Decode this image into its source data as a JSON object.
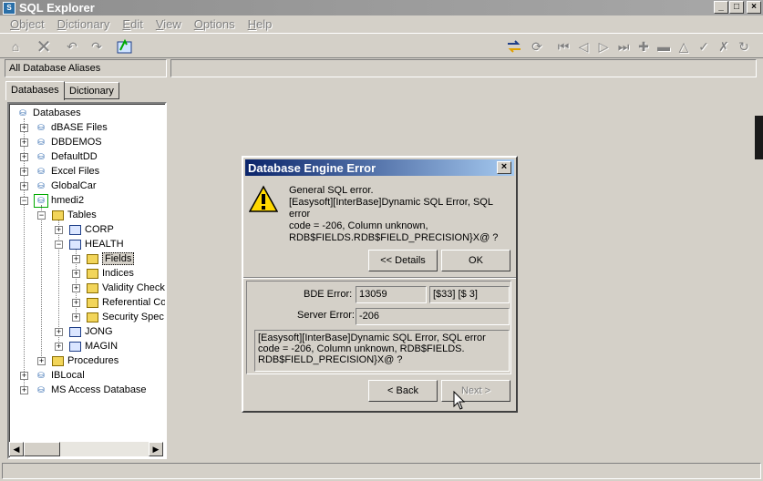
{
  "window": {
    "title": "SQL Explorer"
  },
  "menu": [
    {
      "label": "Object",
      "u": "O",
      "rest": "bject"
    },
    {
      "label": "Dictionary",
      "u": "D",
      "rest": "ictionary"
    },
    {
      "label": "Edit",
      "u": "E",
      "rest": "dit"
    },
    {
      "label": "View",
      "u": "V",
      "rest": "iew"
    },
    {
      "label": "Options",
      "u": "O",
      "rest": "ptions"
    },
    {
      "label": "Help",
      "u": "H",
      "rest": "elp"
    }
  ],
  "toolbar": {
    "left_icons": [
      "open-icon",
      "delete-icon",
      "undo-icon",
      "redo-icon",
      "query-icon"
    ],
    "right_icons": [
      "refresh-icon",
      "sync-icon",
      "first-icon",
      "prior-icon",
      "next-icon",
      "last-icon",
      "insert-icon",
      "delete-record-icon",
      "edit-icon",
      "post-icon",
      "cancel-icon",
      "refresh-data-icon"
    ]
  },
  "alias_bar": {
    "label": "All Database Aliases"
  },
  "tabs": {
    "databases": "Databases",
    "dictionary": "Dictionary"
  },
  "tree": {
    "root": "Databases",
    "items": {
      "dbase": "dBASE Files",
      "dbdemos": "DBDEMOS",
      "defaultdd": "DefaultDD",
      "excel": "Excel Files",
      "globalcar": "GlobalCar",
      "hmedi2": "hmedi2",
      "tables": "Tables",
      "corp": "CORP",
      "health": "HEALTH",
      "fields": "Fields",
      "indices": "Indices",
      "validity": "Validity Check",
      "referential": "Referential Co",
      "security": "Security Spec",
      "jong": "JONG",
      "magin": "MAGIN",
      "procedures": "Procedures",
      "iblocal": "IBLocal",
      "msaccess": "MS Access Database"
    }
  },
  "dialog": {
    "title": "Database Engine Error",
    "message_lines": [
      "General SQL error.",
      "[Easysoft][InterBase]Dynamic SQL Error, SQL error",
      "code = -206, Column unknown,",
      "RDB$FIELDS.RDB$FIELD_PRECISION}X@ ?"
    ],
    "details_button": "<< Details",
    "ok_button": "OK",
    "bde_error_label": "BDE Error:",
    "bde_error_code": "13059",
    "bde_error_ctx": "[$33] [$ 3]",
    "server_error_label": "Server Error:",
    "server_error_code": "-206",
    "error_text": "[Easysoft][InterBase]Dynamic SQL Error, SQL error code = -206, Column unknown, RDB$FIELDS. RDB$FIELD_PRECISION}X@ ?",
    "back_button": "< Back",
    "next_button": "Next >"
  },
  "colors": {
    "face": "#d4d0c8",
    "dialog_title_start": "#0a246a",
    "dialog_title_end": "#a6caf0",
    "inactive_title": "#8e8e8e"
  }
}
